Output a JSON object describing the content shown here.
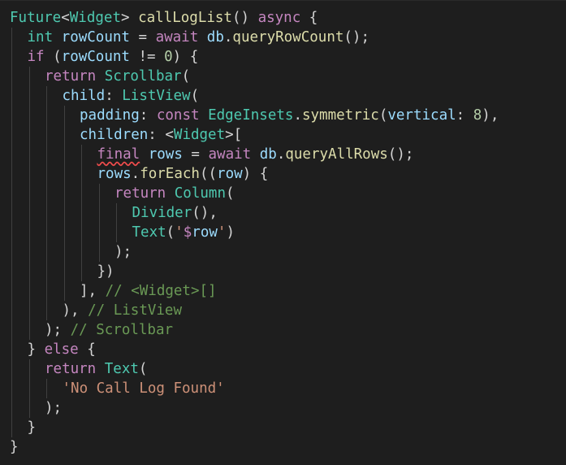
{
  "editor": {
    "language": "dart",
    "theme_colors": {
      "background": "#1e1e1e",
      "class": "#4ec9b0",
      "function": "#dcdcaa",
      "keyword": "#c586c0",
      "variable": "#9cdcfe",
      "number": "#b5cea8",
      "string": "#ce9178",
      "comment": "#6a9955",
      "punctuation": "#d4d4d4",
      "error_underline": "#f14c4c"
    },
    "lines": [
      {
        "indent": 0,
        "tokens": [
          [
            "cls",
            "Future"
          ],
          [
            "pun",
            "<"
          ],
          [
            "cls",
            "Widget"
          ],
          [
            "pun",
            "> "
          ],
          [
            "fn",
            "callLogList"
          ],
          [
            "pun",
            "() "
          ],
          [
            "kw",
            "async"
          ],
          [
            "pun",
            " {"
          ]
        ]
      },
      {
        "indent": 1,
        "tokens": [
          [
            "cls",
            "int"
          ],
          [
            "pun",
            " "
          ],
          [
            "var",
            "rowCount"
          ],
          [
            "pun",
            " = "
          ],
          [
            "kw",
            "await"
          ],
          [
            "pun",
            " "
          ],
          [
            "var",
            "db"
          ],
          [
            "pun",
            "."
          ],
          [
            "fn",
            "queryRowCount"
          ],
          [
            "pun",
            "();"
          ]
        ]
      },
      {
        "indent": 1,
        "tokens": [
          [
            "kw",
            "if"
          ],
          [
            "pun",
            " ("
          ],
          [
            "var",
            "rowCount"
          ],
          [
            "pun",
            " != "
          ],
          [
            "num",
            "0"
          ],
          [
            "pun",
            ") {"
          ]
        ]
      },
      {
        "indent": 2,
        "tokens": [
          [
            "kw",
            "return"
          ],
          [
            "pun",
            " "
          ],
          [
            "cls",
            "Scrollbar"
          ],
          [
            "pun",
            "("
          ]
        ]
      },
      {
        "indent": 3,
        "tokens": [
          [
            "var",
            "child"
          ],
          [
            "pun",
            ": "
          ],
          [
            "cls",
            "ListView"
          ],
          [
            "pun",
            "("
          ]
        ]
      },
      {
        "indent": 4,
        "tokens": [
          [
            "var",
            "padding"
          ],
          [
            "pun",
            ": "
          ],
          [
            "kw",
            "const"
          ],
          [
            "pun",
            " "
          ],
          [
            "cls",
            "EdgeInsets"
          ],
          [
            "pun",
            "."
          ],
          [
            "fn",
            "symmetric"
          ],
          [
            "pun",
            "("
          ],
          [
            "var",
            "vertical"
          ],
          [
            "pun",
            ": "
          ],
          [
            "num",
            "8"
          ],
          [
            "pun",
            "),"
          ]
        ]
      },
      {
        "indent": 4,
        "tokens": [
          [
            "var",
            "children"
          ],
          [
            "pun",
            ": <"
          ],
          [
            "cls",
            "Widget"
          ],
          [
            "pun",
            ">["
          ]
        ]
      },
      {
        "indent": 5,
        "tokens": [
          [
            "kw",
            "final",
            "err"
          ],
          [
            "pun",
            " "
          ],
          [
            "var",
            "rows"
          ],
          [
            "pun",
            " = "
          ],
          [
            "kw",
            "await"
          ],
          [
            "pun",
            " "
          ],
          [
            "var",
            "db"
          ],
          [
            "pun",
            "."
          ],
          [
            "fn",
            "queryAllRows"
          ],
          [
            "pun",
            "();"
          ]
        ]
      },
      {
        "indent": 5,
        "tokens": [
          [
            "var",
            "rows"
          ],
          [
            "pun",
            "."
          ],
          [
            "fn",
            "forEach"
          ],
          [
            "pun",
            "(("
          ],
          [
            "var",
            "row"
          ],
          [
            "pun",
            ") {"
          ]
        ]
      },
      {
        "indent": 6,
        "tokens": [
          [
            "kw",
            "return"
          ],
          [
            "pun",
            " "
          ],
          [
            "cls",
            "Column"
          ],
          [
            "pun",
            "("
          ]
        ]
      },
      {
        "indent": 7,
        "tokens": [
          [
            "cls",
            "Divider"
          ],
          [
            "pun",
            "(),"
          ]
        ]
      },
      {
        "indent": 7,
        "tokens": [
          [
            "cls",
            "Text"
          ],
          [
            "pun",
            "("
          ],
          [
            "str",
            "'"
          ],
          [
            "kw",
            "$"
          ],
          [
            "var",
            "row"
          ],
          [
            "str",
            "'"
          ],
          [
            "pun",
            ")"
          ]
        ]
      },
      {
        "indent": 6,
        "tokens": [
          [
            "pun",
            ");"
          ]
        ]
      },
      {
        "indent": 5,
        "tokens": [
          [
            "pun",
            "})"
          ]
        ]
      },
      {
        "indent": 4,
        "tokens": [
          [
            "pun",
            "], "
          ],
          [
            "cmt",
            "// <Widget>[]"
          ]
        ]
      },
      {
        "indent": 3,
        "tokens": [
          [
            "pun",
            "), "
          ],
          [
            "cmt",
            "// ListView"
          ]
        ]
      },
      {
        "indent": 2,
        "tokens": [
          [
            "pun",
            "); "
          ],
          [
            "cmt",
            "// Scrollbar"
          ]
        ]
      },
      {
        "indent": 1,
        "tokens": [
          [
            "pun",
            "} "
          ],
          [
            "kw",
            "else"
          ],
          [
            "pun",
            " {"
          ]
        ]
      },
      {
        "indent": 2,
        "tokens": [
          [
            "kw",
            "return"
          ],
          [
            "pun",
            " "
          ],
          [
            "cls",
            "Text"
          ],
          [
            "pun",
            "("
          ]
        ]
      },
      {
        "indent": 3,
        "tokens": [
          [
            "str",
            "'No Call Log Found'"
          ]
        ]
      },
      {
        "indent": 2,
        "tokens": [
          [
            "pun",
            ");"
          ]
        ]
      },
      {
        "indent": 1,
        "tokens": [
          [
            "pun",
            "}"
          ]
        ]
      },
      {
        "indent": 0,
        "tokens": [
          [
            "pun",
            "}"
          ]
        ]
      }
    ]
  }
}
